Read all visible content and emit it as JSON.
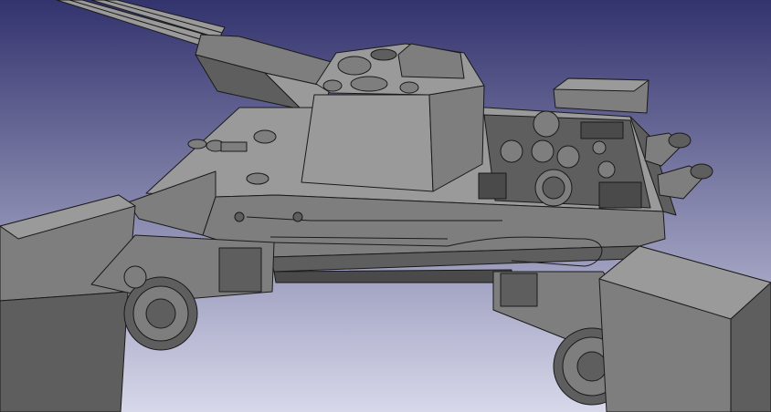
{
  "viewport": {
    "background_top": "#33336e",
    "background_bottom": "#d7d8ea"
  },
  "model": {
    "edge_color": "#1a1a1a",
    "face_light": "#9a9a9a",
    "face_mid": "#7e7e7e",
    "face_dark": "#5e5e5e",
    "face_darker": "#4a4a4a"
  }
}
